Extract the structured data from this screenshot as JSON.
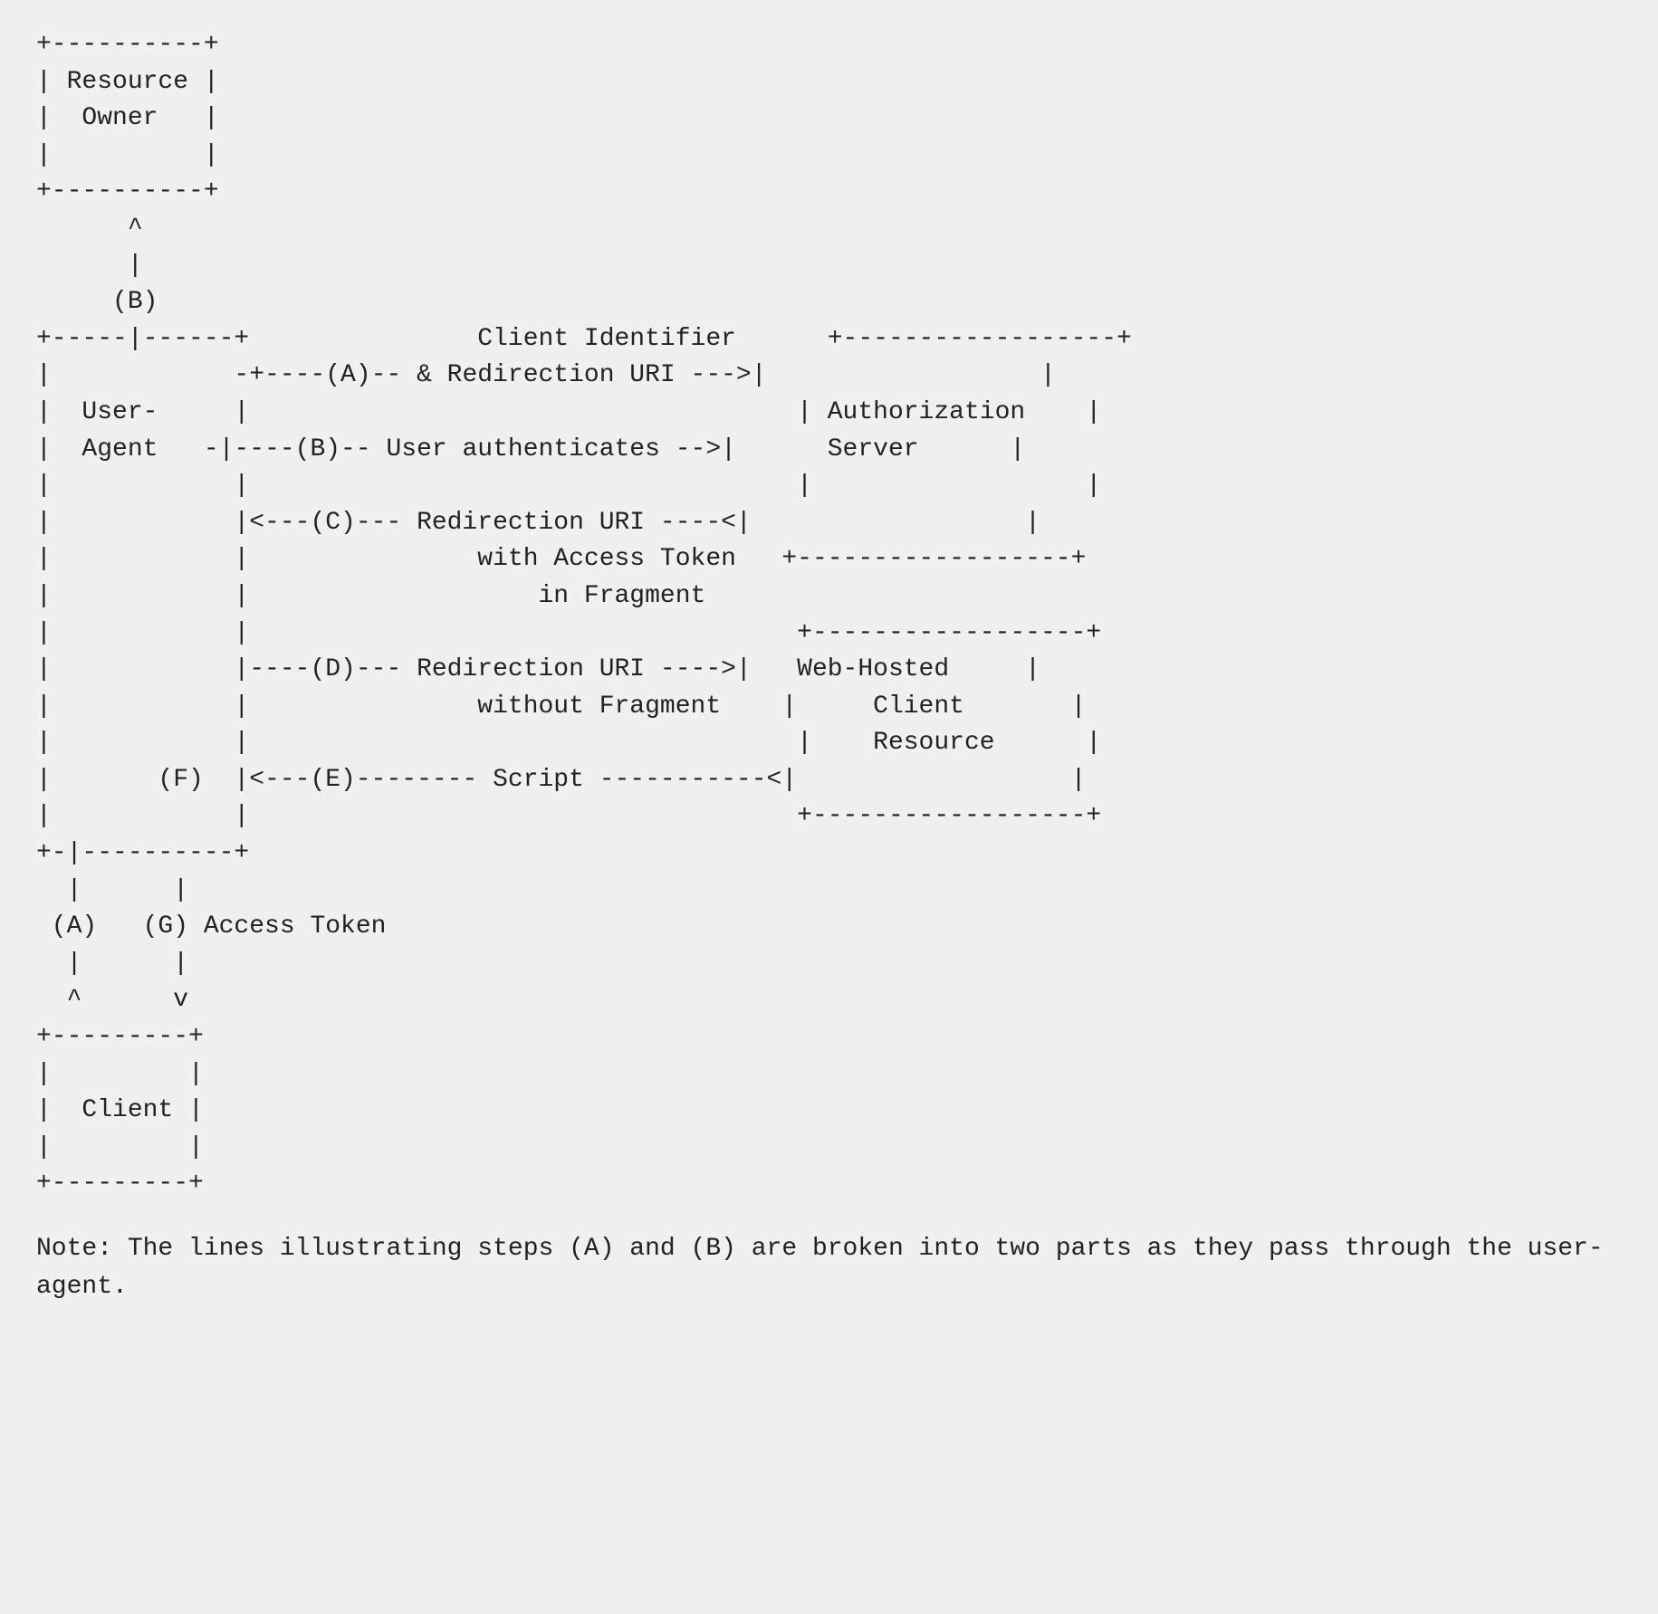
{
  "diagram": {
    "lines": [
      "+----------+",
      "| Resource |",
      "|  Owner   |",
      "|          |",
      "+----------+",
      "       ^",
      "       |",
      "      (B)",
      "+-----|------+               Client Identifier      +------------------+",
      "|            -+----(A)-- & Redirection URI --->|                  |",
      "|  User-     |                                    | Authorization    |",
      "|  Agent   -|----- (B)-- User authenticates -->|      Server      |",
      "|            |                                    |                  |",
      "|            |<---(C)--- Redirection URI ----<|                  |",
      "|            |               with Access Token   +------------------+",
      "|            |                   in Fragment",
      "|            |                                    +------------------+",
      "|            |----(D)--- Redirection URI ---->|   Web-Hosted     |",
      "|            |               without Fragment    |     Client       |",
      "|            |                                    |    Resource      |",
      "|       (F)  |<---(E)-------- Script -----------<|                  |",
      "|            |                                    +------------------+",
      "+-|----------+",
      "  |      |",
      " (A)   (G) Access Token",
      "  |      |",
      "  ^      v",
      "+---------+",
      "|         |",
      "|  Client |",
      "|         |",
      "+---------+"
    ],
    "note": "Note: The lines illustrating steps (A) and (B) are broken into two\nparts as they pass through the user-agent."
  }
}
